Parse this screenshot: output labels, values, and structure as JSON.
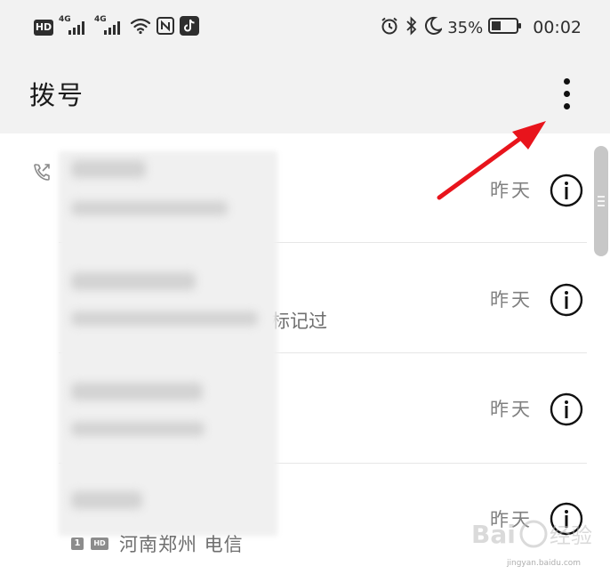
{
  "status_bar": {
    "hd": "HD",
    "network_1": "4G",
    "network_2": "4G",
    "battery_percent": "35%",
    "time": "00:02",
    "icons": [
      "hd-icon",
      "signal-icon",
      "wifi-icon",
      "nfc-icon",
      "tiktok-icon",
      "alarm-icon",
      "bluetooth-icon",
      "do-not-disturb-icon",
      "battery-icon"
    ]
  },
  "header": {
    "title": "拨号",
    "more_icon": "more-vertical-icon"
  },
  "call_log": {
    "items": [
      {
        "time": "昨天",
        "subtitle": "",
        "call_type_icon": "outgoing-call-icon",
        "info_icon": "info-icon"
      },
      {
        "time": "昨天",
        "subtitle": "标记过",
        "info_icon": "info-icon"
      },
      {
        "time": "昨天",
        "subtitle": "",
        "info_icon": "info-icon"
      },
      {
        "time": "昨天",
        "subtitle": "",
        "info_icon": "info-icon"
      }
    ],
    "last_item_sim": "1",
    "last_item_hd": "HD",
    "last_item_location": "河南郑州 电信"
  },
  "colors": {
    "header_background": "#f2f2f2",
    "list_background": "#ffffff",
    "annotation_arrow": "#e8141c",
    "secondary_text": "#808080"
  },
  "watermark": {
    "text": "Bai 经验",
    "url": "jingyan.baidu.com"
  }
}
